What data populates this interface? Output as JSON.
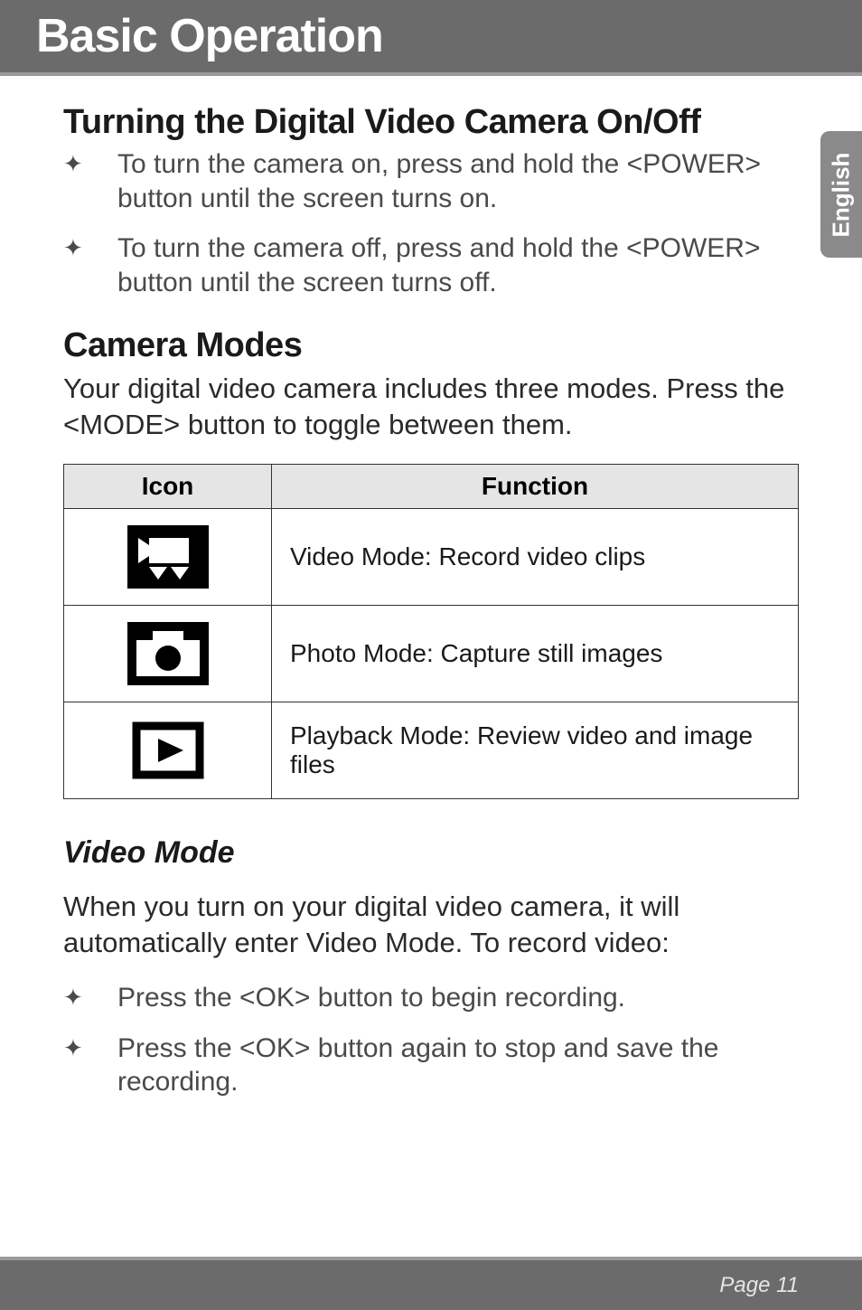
{
  "header": {
    "title": "Basic Operation"
  },
  "side_tab": {
    "label": "English"
  },
  "section1": {
    "heading": "Turning the Digital Video Camera On/Off",
    "bullets": [
      "To turn the camera on, press and hold the <POWER> button until the screen turns on.",
      "To turn the camera off, press and hold the <POWER> button until the screen turns off."
    ]
  },
  "section2": {
    "heading": "Camera Modes",
    "intro": "Your digital video camera includes three modes. Press the <MODE> button to toggle between them.",
    "table": {
      "headers": [
        "Icon",
        "Function"
      ],
      "rows": [
        {
          "icon": "video-camera-icon",
          "function": "Video Mode: Record video clips"
        },
        {
          "icon": "photo-camera-icon",
          "function": "Photo Mode: Capture still images"
        },
        {
          "icon": "playback-icon",
          "function": "Playback Mode: Review video and image files"
        }
      ]
    }
  },
  "section3": {
    "heading": "Video Mode",
    "intro": "When you turn on your digital video camera, it will automatically enter Video Mode.  To record video:",
    "bullets": [
      "Press the <OK> button to begin recording.",
      "Press the <OK> button again to stop and save the recording."
    ]
  },
  "footer": {
    "page_label": "Page 11"
  }
}
